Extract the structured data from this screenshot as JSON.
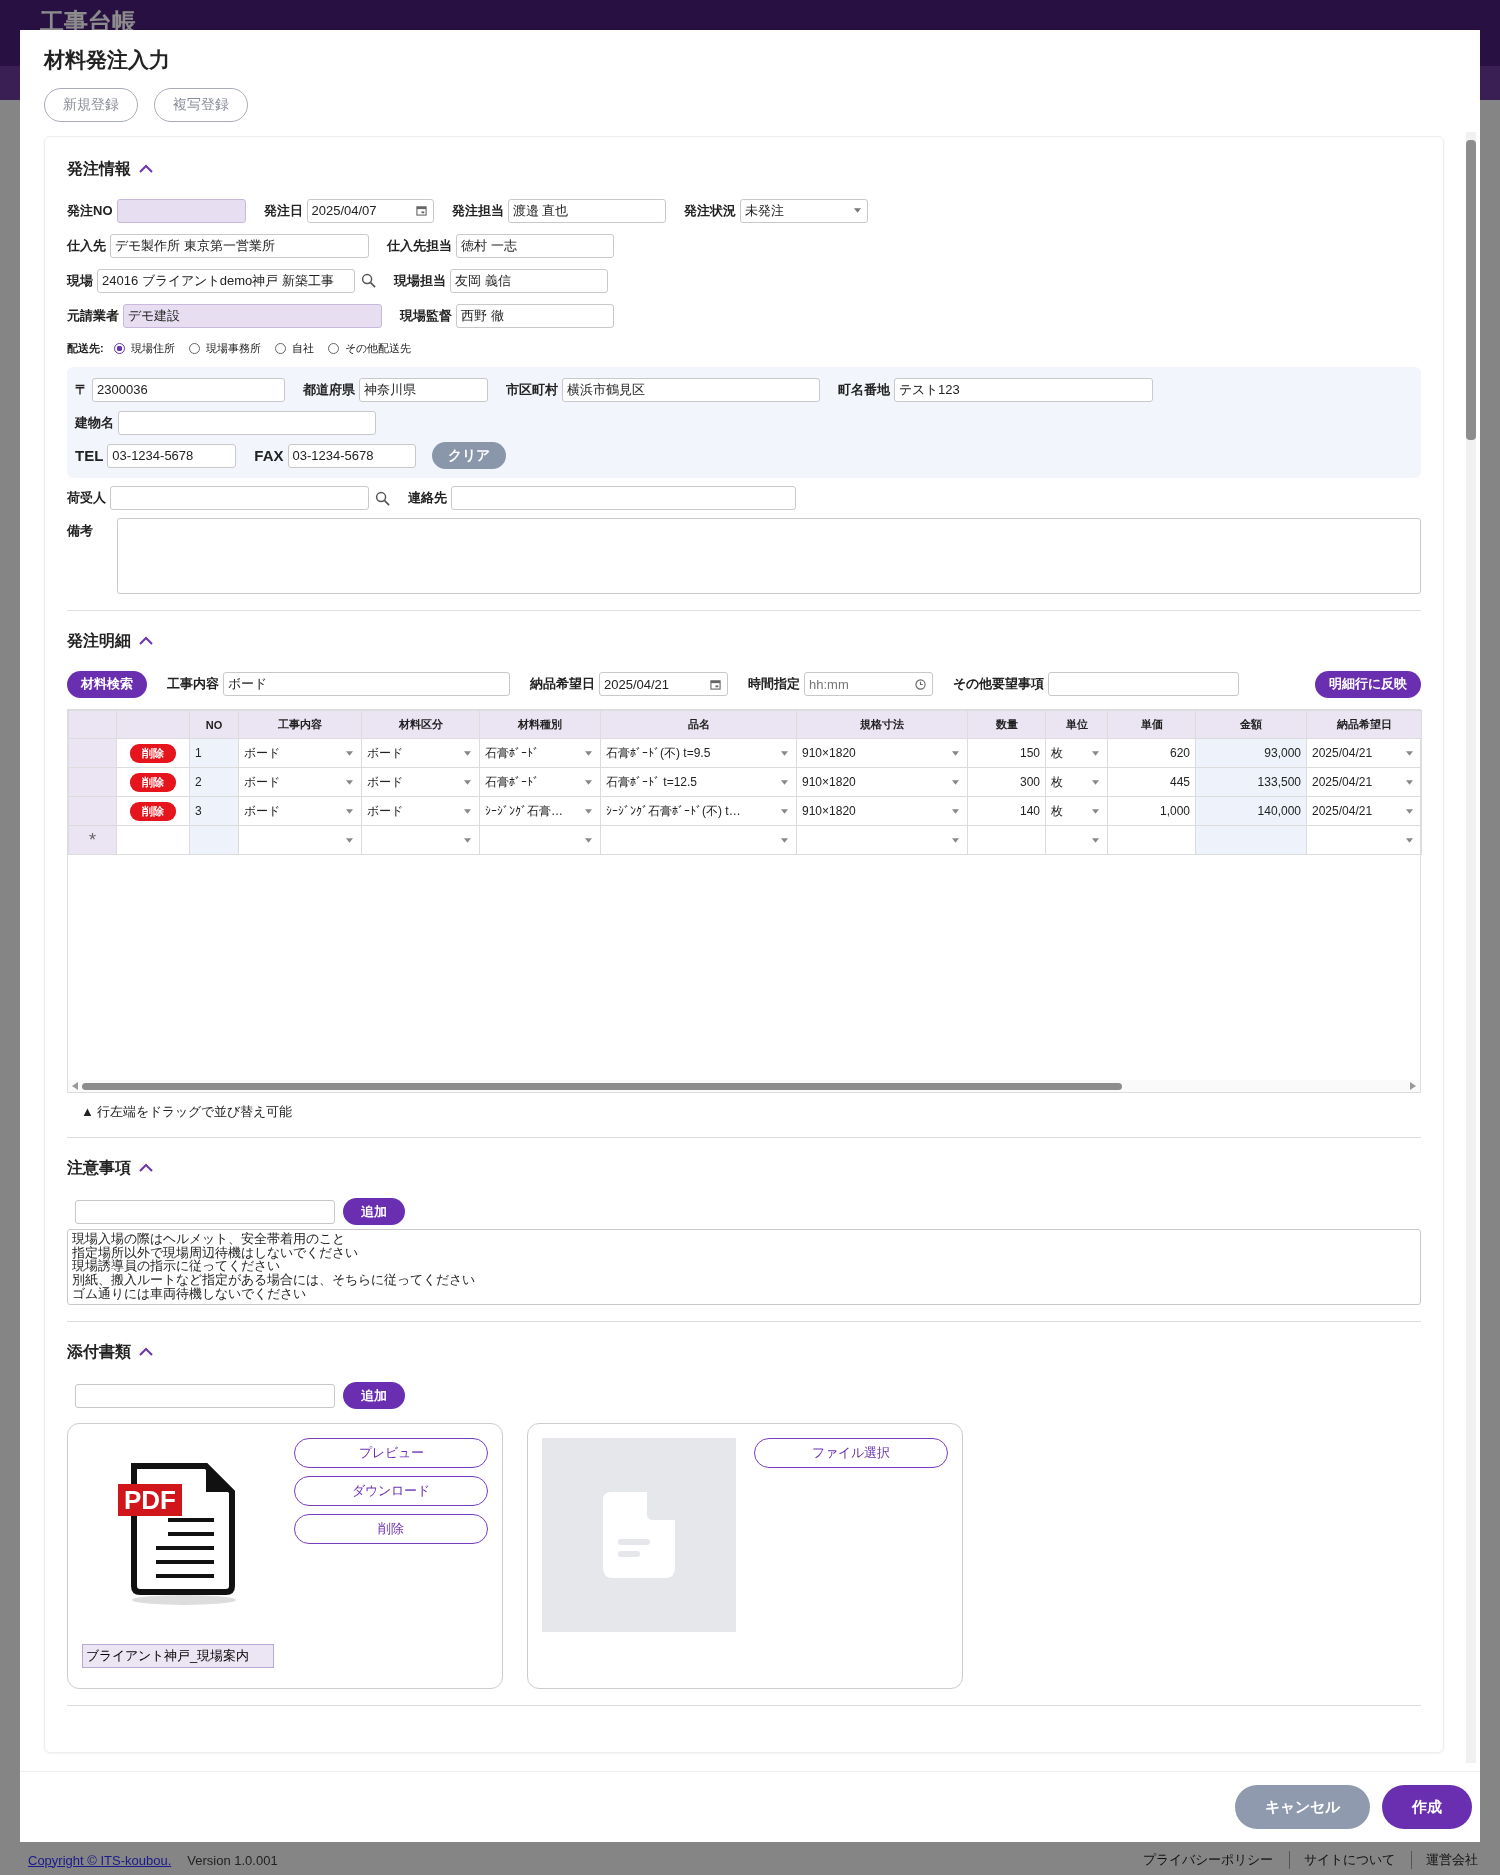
{
  "app": {
    "title": "工事台帳"
  },
  "dialog": {
    "title": "材料発注入力",
    "mode_buttons": [
      {
        "label": "新規登録"
      },
      {
        "label": "複写登録"
      }
    ]
  },
  "order_info": {
    "title": "発注情報",
    "expanded": true,
    "rows": [
      [
        {
          "label": "発注NO",
          "kind": "text",
          "readonly": true
        },
        {
          "label": "発注日",
          "kind": "date",
          "value": "2025/04/07",
          "readonly": false
        },
        {
          "label": "発注担当",
          "kind": "text",
          "value": "渡邉 直也",
          "readonly": false
        },
        {
          "label": "発注状況",
          "kind": "select",
          "value": "未発注",
          "readonly": false
        }
      ],
      [
        {
          "label": "仕入先",
          "kind": "text",
          "value": "デモ製作所 東京第一営業所",
          "readonly": false
        },
        {
          "label": "仕入先担当",
          "kind": "text",
          "value": "徳村 一志",
          "readonly": false
        }
      ],
      [
        {
          "label": "現場",
          "kind": "search",
          "value": "24016 ブライアントdemo神戸 新築工事",
          "readonly": false
        },
        {
          "label": "現場担当",
          "kind": "text",
          "value": "友岡 義信",
          "readonly": false
        }
      ],
      [
        {
          "label": "元請業者",
          "kind": "text",
          "value": "デモ建設",
          "readonly": true
        },
        {
          "label": "現場監督",
          "kind": "text",
          "value": "西野 徹",
          "readonly": false
        }
      ]
    ]
  },
  "delivery": {
    "label": "配送先:",
    "options": [
      {
        "label": "現場住所",
        "selected": true
      },
      {
        "label": "現場事務所",
        "selected": false
      },
      {
        "label": "自社",
        "selected": false
      },
      {
        "label": "その他配送先",
        "selected": false
      }
    ]
  },
  "address": {
    "rows": [
      [
        {
          "label": "〒",
          "value": "2300036"
        },
        {
          "label": "都道府県",
          "value": "神奈川県"
        },
        {
          "label": "市区町村",
          "value": "横浜市鶴見区"
        },
        {
          "label": "町名番地",
          "value": "テスト123"
        }
      ],
      [
        {
          "label": "建物名"
        }
      ],
      [
        {
          "label": "TEL",
          "value": "03-1234-5678"
        },
        {
          "label": "FAX",
          "value": "03-1234-5678"
        }
      ]
    ],
    "clear_button": "クリア"
  },
  "consignee": [
    {
      "label": "荷受人",
      "kind": "search"
    },
    {
      "label": "連絡先",
      "kind": "text"
    }
  ],
  "remarks": {
    "label": "備考"
  },
  "details": {
    "title": "発注明細",
    "expanded": true,
    "search_button": "材料検索",
    "filters": [
      {
        "label": "工事内容",
        "kind": "text",
        "value": "ボード"
      },
      {
        "label": "納品希望日",
        "kind": "date",
        "value": "2025/04/21"
      },
      {
        "label": "時間指定",
        "kind": "time",
        "placeholder": "hh:mm"
      },
      {
        "label": "その他要望事項",
        "kind": "text"
      }
    ],
    "apply_button": "明細行に反映",
    "columns": [
      {
        "label": "NO",
        "kind": "readonly"
      },
      {
        "label": "工事内容",
        "kind": "select"
      },
      {
        "label": "材料区分",
        "kind": "select"
      },
      {
        "label": "材料種別",
        "kind": "select"
      },
      {
        "label": "品名",
        "kind": "select"
      },
      {
        "label": "規格寸法",
        "kind": "select"
      },
      {
        "label": "数量",
        "kind": "number"
      },
      {
        "label": "単位",
        "kind": "select"
      },
      {
        "label": "単価",
        "kind": "number"
      },
      {
        "label": "金額",
        "kind": "computed"
      },
      {
        "label": "納品希望日",
        "kind": "select"
      }
    ],
    "rows": [
      {
        "delete": "削除",
        "cells": [
          "1",
          "ボード",
          "ボード",
          "石膏ﾎﾞｰﾄﾞ",
          "石膏ﾎﾞｰﾄﾞ(不) t=9.5",
          "910×1820",
          "150",
          "枚",
          "620",
          "93,000",
          "2025/04/21"
        ]
      },
      {
        "delete": "削除",
        "cells": [
          "2",
          "ボード",
          "ボード",
          "石膏ﾎﾞｰﾄﾞ",
          "石膏ﾎﾞｰﾄﾞ t=12.5",
          "910×1820",
          "300",
          "枚",
          "445",
          "133,500",
          "2025/04/21"
        ]
      },
      {
        "delete": "削除",
        "cells": [
          "3",
          "ボード",
          "ボード",
          "ｼｰｼﾞﾝｸﾞ石膏…",
          "ｼｰｼﾞﾝｸﾞ石膏ﾎﾞｰﾄﾞ(不) t…",
          "910×1820",
          "140",
          "枚",
          "1,000",
          "140,000",
          "2025/04/21"
        ]
      }
    ],
    "new_row_mark": "*",
    "hint": "▲ 行左端をドラッグで並び替え可能"
  },
  "cautions": {
    "title": "注意事項",
    "expanded": true,
    "add_button": "追加",
    "lines": [
      "現場入場の際はヘルメット、安全帯着用のこと",
      "指定場所以外で現場周辺待機はしないでください",
      "現場誘導員の指示に従ってください",
      "別紙、搬入ルートなど指定がある場合には、そちらに従ってください",
      "ゴム通りには車両待機しないでください"
    ]
  },
  "attachments": {
    "title": "添付書類",
    "expanded": true,
    "add_button": "追加",
    "files": [
      {
        "kind": "file",
        "icon_label": "PDF",
        "name": "ブライアント神戸_現場案内",
        "buttons": [
          "プレビュー",
          "ダウンロード",
          "削除"
        ]
      },
      {
        "kind": "empty",
        "buttons": [
          "ファイル選択"
        ]
      }
    ]
  },
  "actions": [
    {
      "label": "キャンセル",
      "kind": "secondary"
    },
    {
      "label": "作成",
      "kind": "primary"
    }
  ],
  "footer": {
    "copyright": "Copyright © ITS-koubou.",
    "version": "Version 1.0.001",
    "links": [
      "プライバシーポリシー",
      "サイトについて",
      "運営会社"
    ]
  }
}
